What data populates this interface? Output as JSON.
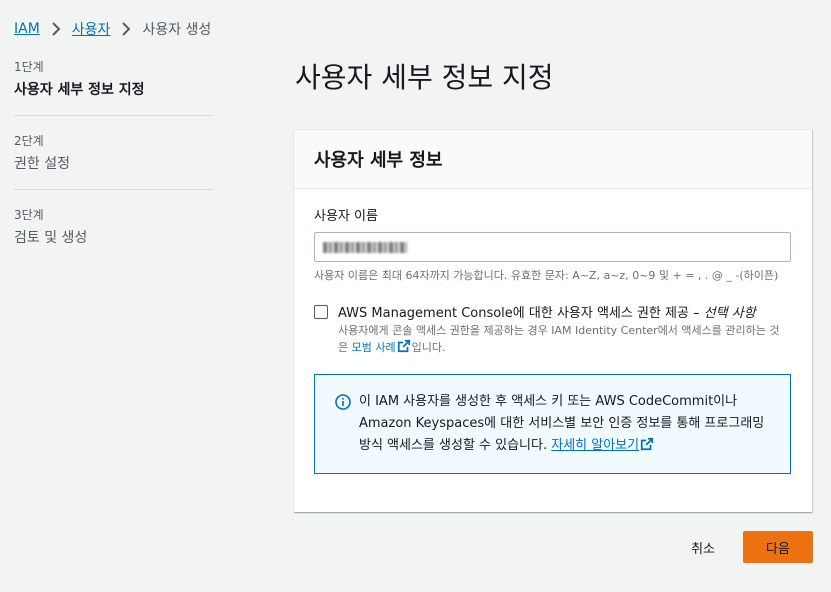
{
  "breadcrumb": {
    "iam": "IAM",
    "users": "사용자",
    "current": "사용자 생성"
  },
  "steps": [
    {
      "no": "1단계",
      "title": "사용자 세부 정보 지정"
    },
    {
      "no": "2단계",
      "title": "권한 설정"
    },
    {
      "no": "3단계",
      "title": "검토 및 생성"
    }
  ],
  "page_title": "사용자 세부 정보 지정",
  "panel": {
    "title": "사용자 세부 정보",
    "username_label": "사용자 이름",
    "username_hint": "사용자 이름은 최대 64자까지 가능합니다. 유효한 문자: A~Z, a~z, 0~9 및 + = , . @ _ -(하이픈)",
    "console_checkbox_label": "AWS Management Console에 대한 사용자 액세스 권한 제공 – ",
    "console_checkbox_optional": "선택 사항",
    "console_desc_pre": "사용자에게 콘솔 액세스 권한을 제공하는 경우 IAM Identity Center에서 액세스를 관리하는 것은 ",
    "console_desc_link": "모범 사례",
    "console_desc_post": "입니다.",
    "info_text": "이 IAM 사용자를 생성한 후 액세스 키 또는 AWS CodeCommit이나 Amazon Keyspaces에 대한 서비스별 보안 인증 정보를 통해 프로그래밍 방식 액세스를 생성할 수 있습니다. ",
    "info_link": "자세히 알아보기"
  },
  "actions": {
    "cancel": "취소",
    "next": "다음"
  },
  "colors": {
    "primary": "#ec7211",
    "link": "#0073bb",
    "info_bg": "#f1faff"
  }
}
